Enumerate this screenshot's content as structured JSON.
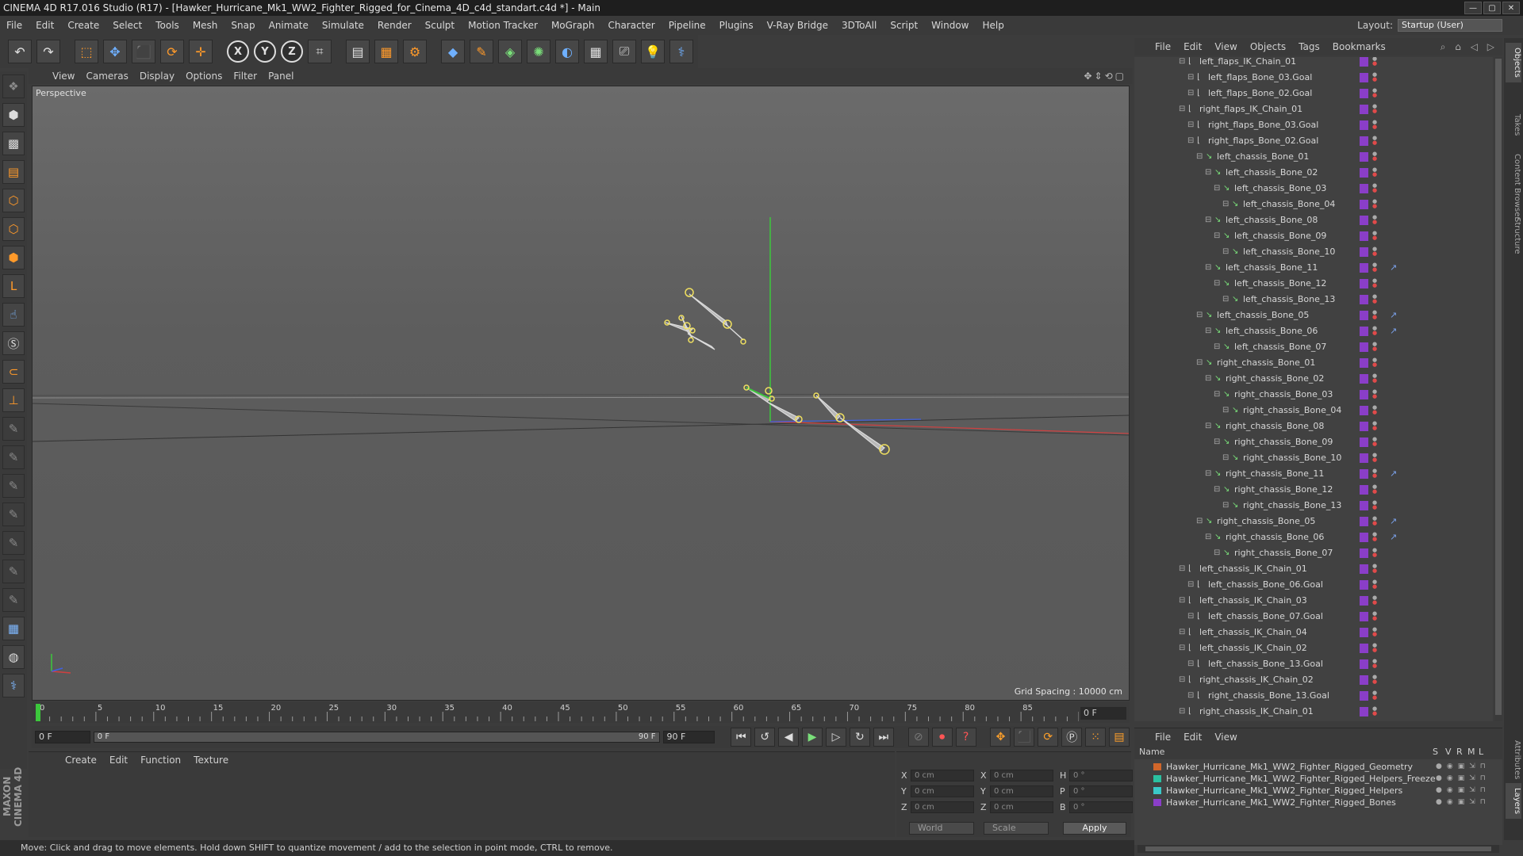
{
  "window": {
    "title": "CINEMA 4D R17.016 Studio (R17) - [Hawker_Hurricane_Mk1_WW2_Fighter_Rigged_for_Cinema_4D_c4d_standart.c4d *] - Main"
  },
  "menu": [
    "File",
    "Edit",
    "Create",
    "Select",
    "Tools",
    "Mesh",
    "Snap",
    "Animate",
    "Simulate",
    "Render",
    "Sculpt",
    "Motion Tracker",
    "MoGraph",
    "Character",
    "Pipeline",
    "Plugins",
    "V-Ray Bridge",
    "3DToAll",
    "Script",
    "Window",
    "Help"
  ],
  "layout": {
    "label": "Layout:",
    "value": "Startup (User)"
  },
  "viewport_menu": [
    "View",
    "Cameras",
    "Display",
    "Options",
    "Filter",
    "Panel"
  ],
  "viewport": {
    "label": "Perspective",
    "grid_spacing": "Grid Spacing : 10000 cm"
  },
  "timeline": {
    "ticks": [
      "0",
      "5",
      "10",
      "15",
      "20",
      "25",
      "30",
      "35",
      "40",
      "45",
      "50",
      "55",
      "60",
      "65",
      "70",
      "75",
      "80",
      "85",
      "90"
    ],
    "frame": "0 F"
  },
  "transport": {
    "current": "0 F",
    "range_start": "0 F",
    "range_end": "90 F",
    "end": "90 F"
  },
  "material_menu": [
    "Create",
    "Edit",
    "Function",
    "Texture"
  ],
  "coords": {
    "rows": [
      {
        "a": "X",
        "av": "0 cm",
        "b": "X",
        "bv": "0 cm",
        "c": "H",
        "cv": "0 °"
      },
      {
        "a": "Y",
        "av": "0 cm",
        "b": "Y",
        "bv": "0 cm",
        "c": "P",
        "cv": "0 °"
      },
      {
        "a": "Z",
        "av": "0 cm",
        "b": "Z",
        "bv": "0 cm",
        "c": "B",
        "cv": "0 °"
      }
    ],
    "space": "World",
    "mode": "Scale",
    "apply": "Apply"
  },
  "status": "Move: Click and drag to move elements. Hold down SHIFT to quantize movement / add to the selection in point mode, CTRL to remove.",
  "object_menu": [
    "File",
    "Edit",
    "View",
    "Objects",
    "Tags",
    "Bookmarks"
  ],
  "objects": [
    {
      "name": "left_flaps_IK_Chain_01",
      "depth": 0,
      "type": "ik"
    },
    {
      "name": "left_flaps_Bone_03.Goal",
      "depth": 1,
      "type": "ik"
    },
    {
      "name": "left_flaps_Bone_02.Goal",
      "depth": 1,
      "type": "ik"
    },
    {
      "name": "right_flaps_IK_Chain_01",
      "depth": 0,
      "type": "ik"
    },
    {
      "name": "right_flaps_Bone_03.Goal",
      "depth": 1,
      "type": "ik"
    },
    {
      "name": "right_flaps_Bone_02.Goal",
      "depth": 1,
      "type": "ik"
    },
    {
      "name": "left_chassis_Bone_01",
      "depth": 2,
      "type": "bone"
    },
    {
      "name": "left_chassis_Bone_02",
      "depth": 3,
      "type": "bone"
    },
    {
      "name": "left_chassis_Bone_03",
      "depth": 4,
      "type": "bone"
    },
    {
      "name": "left_chassis_Bone_04",
      "depth": 5,
      "type": "bone"
    },
    {
      "name": "left_chassis_Bone_08",
      "depth": 3,
      "type": "bone"
    },
    {
      "name": "left_chassis_Bone_09",
      "depth": 4,
      "type": "bone"
    },
    {
      "name": "left_chassis_Bone_10",
      "depth": 5,
      "type": "bone"
    },
    {
      "name": "left_chassis_Bone_11",
      "depth": 3,
      "type": "bone",
      "extra": true
    },
    {
      "name": "left_chassis_Bone_12",
      "depth": 4,
      "type": "bone"
    },
    {
      "name": "left_chassis_Bone_13",
      "depth": 5,
      "type": "bone"
    },
    {
      "name": "left_chassis_Bone_05",
      "depth": 2,
      "type": "bone",
      "extra": true
    },
    {
      "name": "left_chassis_Bone_06",
      "depth": 3,
      "type": "bone",
      "extra": true
    },
    {
      "name": "left_chassis_Bone_07",
      "depth": 4,
      "type": "bone"
    },
    {
      "name": "right_chassis_Bone_01",
      "depth": 2,
      "type": "bone"
    },
    {
      "name": "right_chassis_Bone_02",
      "depth": 3,
      "type": "bone"
    },
    {
      "name": "right_chassis_Bone_03",
      "depth": 4,
      "type": "bone"
    },
    {
      "name": "right_chassis_Bone_04",
      "depth": 5,
      "type": "bone"
    },
    {
      "name": "right_chassis_Bone_08",
      "depth": 3,
      "type": "bone"
    },
    {
      "name": "right_chassis_Bone_09",
      "depth": 4,
      "type": "bone"
    },
    {
      "name": "right_chassis_Bone_10",
      "depth": 5,
      "type": "bone"
    },
    {
      "name": "right_chassis_Bone_11",
      "depth": 3,
      "type": "bone",
      "extra": true
    },
    {
      "name": "right_chassis_Bone_12",
      "depth": 4,
      "type": "bone"
    },
    {
      "name": "right_chassis_Bone_13",
      "depth": 5,
      "type": "bone"
    },
    {
      "name": "right_chassis_Bone_05",
      "depth": 2,
      "type": "bone",
      "extra": true
    },
    {
      "name": "right_chassis_Bone_06",
      "depth": 3,
      "type": "bone",
      "extra": true
    },
    {
      "name": "right_chassis_Bone_07",
      "depth": 4,
      "type": "bone"
    },
    {
      "name": "left_chassis_IK_Chain_01",
      "depth": 0,
      "type": "ik"
    },
    {
      "name": "left_chassis_Bone_06.Goal",
      "depth": 1,
      "type": "ik"
    },
    {
      "name": "left_chassis_IK_Chain_03",
      "depth": 0,
      "type": "ik"
    },
    {
      "name": "left_chassis_Bone_07.Goal",
      "depth": 1,
      "type": "ik"
    },
    {
      "name": "left_chassis_IK_Chain_04",
      "depth": 0,
      "type": "ik"
    },
    {
      "name": "left_chassis_IK_Chain_02",
      "depth": 0,
      "type": "ik"
    },
    {
      "name": "left_chassis_Bone_13.Goal",
      "depth": 1,
      "type": "ik"
    },
    {
      "name": "right_chassis_IK_Chain_02",
      "depth": 0,
      "type": "ik"
    },
    {
      "name": "right_chassis_Bone_13.Goal",
      "depth": 1,
      "type": "ik"
    },
    {
      "name": "right_chassis_IK_Chain_01",
      "depth": 0,
      "type": "ik"
    }
  ],
  "layer_menu": [
    "File",
    "Edit",
    "View"
  ],
  "layer_header": {
    "name": "Name",
    "cols": [
      "S",
      "V",
      "R",
      "M",
      "L"
    ]
  },
  "layers": [
    {
      "name": "Hawker_Hurricane_Mk1_WW2_Fighter_Rigged_Geometry",
      "color": "#d0662a"
    },
    {
      "name": "Hawker_Hurricane_Mk1_WW2_Fighter_Rigged_Helpers_Freeze",
      "color": "#2ac0a0"
    },
    {
      "name": "Hawker_Hurricane_Mk1_WW2_Fighter_Rigged_Helpers",
      "color": "#3ac8c8"
    },
    {
      "name": "Hawker_Hurricane_Mk1_WW2_Fighter_Rigged_Bones",
      "color": "#8a3ec8"
    }
  ],
  "right_tabs": [
    "Objects",
    "Takes",
    "Content Browser",
    "Structure",
    "Attributes",
    "Layers"
  ]
}
